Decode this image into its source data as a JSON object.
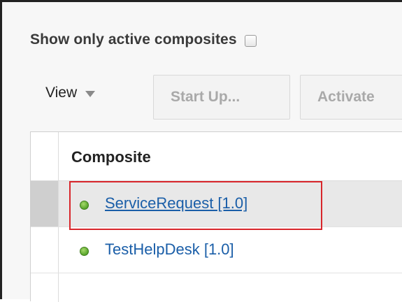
{
  "filter": {
    "label": "Show only active composites",
    "checked": false
  },
  "toolbar": {
    "view_label": "View",
    "start_up_label": "Start Up...",
    "activate_label": "Activate"
  },
  "table": {
    "header": "Composite",
    "rows": [
      {
        "name": "ServiceRequest [1.0]",
        "status": "active",
        "selected": true
      },
      {
        "name": "TestHelpDesk [1.0]",
        "status": "active",
        "selected": false
      }
    ]
  },
  "colors": {
    "link": "#1a5ea8",
    "status_active": "#58a52b",
    "highlight": "#d8262b"
  }
}
